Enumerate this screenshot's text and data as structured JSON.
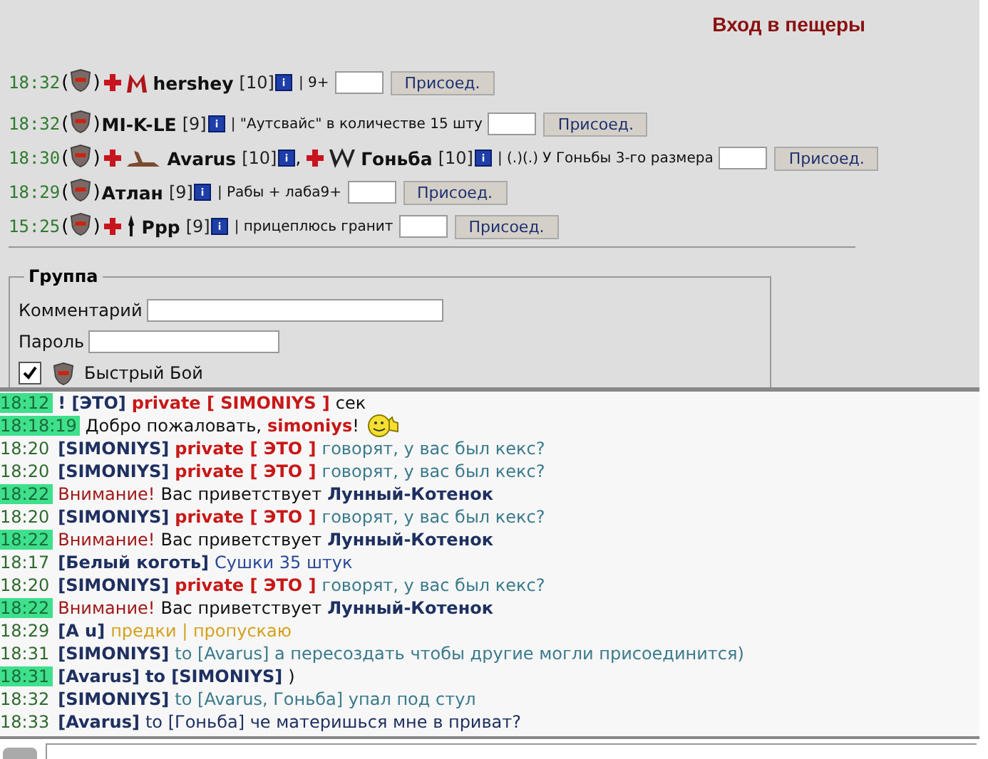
{
  "title": "Вход в пещеры",
  "games": [
    {
      "time": "18:32",
      "open": "(",
      "close": ")",
      "players": [
        {
          "name": "hershey",
          "level": "[10]",
          "cross": true,
          "emblem": {
            "kind": "letter-m"
          }
        }
      ],
      "comment": "| 9+",
      "button": "Присоед."
    },
    {
      "time": "18:32",
      "open": "(",
      "close": ")",
      "players": [
        {
          "name": "MI-K-LE",
          "level": "[9]",
          "cross": false
        }
      ],
      "comment": "| \"Аутсвайс\" в количестве 15 шту",
      "button": "Присоед."
    },
    {
      "time": "18:30",
      "open": "(",
      "close": ")",
      "players": [
        {
          "name": "Avarus",
          "level": "[10]",
          "cross": true,
          "emblem": {
            "kind": "creature"
          }
        },
        {
          "separator": ",",
          "name": "Гоньба",
          "level": "[10]",
          "cross": true,
          "emblem": {
            "kind": "letter-w"
          }
        }
      ],
      "comment": "| (.)(.) У Гоньбы 3-го размера",
      "button": "Присоед."
    },
    {
      "time": "18:29",
      "open": "(",
      "close": ")",
      "players": [
        {
          "name": "Атлан",
          "level": "[9]",
          "cross": false
        }
      ],
      "comment": "| Рабы + лаба9+",
      "button": "Присоед."
    },
    {
      "time": "15:25",
      "open": "(",
      "close": ")",
      "players": [
        {
          "name": "Ppp",
          "level": "[9]",
          "cross": true,
          "emblem": {
            "kind": "dagger"
          }
        }
      ],
      "comment": "| прицеплюсь гранит",
      "button": "Присоед."
    }
  ],
  "group": {
    "legend": "Группа",
    "comment_label": "Комментарий",
    "password_label": "Пароль",
    "quick_fight": {
      "label": "Быстрый Бой",
      "checked": true
    }
  },
  "chat": [
    {
      "time": "18:12",
      "highlight": true,
      "parts": [
        {
          "kind": "name",
          "text": "! [ЭТО]"
        },
        {
          "kind": "private",
          "text": "private [ SIMONIYS ]"
        },
        {
          "kind": "plain",
          "text": "сек"
        }
      ]
    },
    {
      "time": "18:18:19",
      "highlight": true,
      "parts": [
        {
          "kind": "plain",
          "text": "Добро пожаловать,"
        },
        {
          "kind": "private",
          "text": "simoniys"
        },
        {
          "kind": "tail",
          "text": "!"
        },
        {
          "kind": "smiley"
        }
      ]
    },
    {
      "time": "18:20",
      "highlight": false,
      "parts": [
        {
          "kind": "name",
          "text": "[SIMONIYS]"
        },
        {
          "kind": "private",
          "text": "private [ ЭТО ]"
        },
        {
          "kind": "msg",
          "text": "говорят, у вас был кекс?"
        }
      ]
    },
    {
      "time": "18:20",
      "highlight": false,
      "parts": [
        {
          "kind": "name",
          "text": "[SIMONIYS]"
        },
        {
          "kind": "private",
          "text": "private [ ЭТО ]"
        },
        {
          "kind": "msg",
          "text": "говорят, у вас был кекс?"
        }
      ]
    },
    {
      "time": "18:22",
      "highlight": true,
      "parts": [
        {
          "kind": "alert",
          "text": "Внимание!"
        },
        {
          "kind": "plain",
          "text": "Вас приветствует"
        },
        {
          "kind": "name",
          "text": "Лунный-Котенок"
        }
      ]
    },
    {
      "time": "18:20",
      "highlight": false,
      "parts": [
        {
          "kind": "name",
          "text": "[SIMONIYS]"
        },
        {
          "kind": "private",
          "text": "private [ ЭТО ]"
        },
        {
          "kind": "msg",
          "text": "говорят, у вас был кекс?"
        }
      ]
    },
    {
      "time": "18:22",
      "highlight": true,
      "parts": [
        {
          "kind": "alert",
          "text": "Внимание!"
        },
        {
          "kind": "plain",
          "text": "Вас приветствует"
        },
        {
          "kind": "name",
          "text": "Лунный-Котенок"
        }
      ]
    },
    {
      "time": "18:17",
      "highlight": false,
      "parts": [
        {
          "kind": "name",
          "text": "[Белый коготь]"
        },
        {
          "kind": "blue",
          "text": "Сушки 35 штук"
        }
      ]
    },
    {
      "time": "18:20",
      "highlight": false,
      "parts": [
        {
          "kind": "name",
          "text": "[SIMONIYS]"
        },
        {
          "kind": "private",
          "text": "private [ ЭТО ]"
        },
        {
          "kind": "msg",
          "text": "говорят, у вас был кекс?"
        }
      ]
    },
    {
      "time": "18:22",
      "highlight": true,
      "parts": [
        {
          "kind": "alert",
          "text": "Внимание!"
        },
        {
          "kind": "plain",
          "text": "Вас приветствует"
        },
        {
          "kind": "name",
          "text": "Лунный-Котенок"
        }
      ]
    },
    {
      "time": "18:29",
      "highlight": false,
      "parts": [
        {
          "kind": "name",
          "text": "[A u]"
        },
        {
          "kind": "yellow",
          "text": "предки | пропускаю"
        }
      ]
    },
    {
      "time": "18:31",
      "highlight": false,
      "parts": [
        {
          "kind": "name",
          "text": "[SIMONIYS]"
        },
        {
          "kind": "msg",
          "text": "to [Avarus] а пересоздать чтобы другие могли присоединится)"
        }
      ]
    },
    {
      "time": "18:31",
      "highlight": true,
      "parts": [
        {
          "kind": "name",
          "text": "[Avarus]"
        },
        {
          "kind": "name",
          "text": "to [SIMONIYS]"
        },
        {
          "kind": "plain",
          "text": ")"
        }
      ]
    },
    {
      "time": "18:32",
      "highlight": false,
      "parts": [
        {
          "kind": "name",
          "text": "[SIMONIYS]"
        },
        {
          "kind": "msg",
          "text": "to [Avarus, Гоньба] упал под стул"
        }
      ]
    },
    {
      "time": "18:33",
      "highlight": false,
      "parts": [
        {
          "kind": "name",
          "text": "[Avarus]"
        },
        {
          "kind": "dark",
          "text": "to [Гоньба] че материшься мне в приват?"
        }
      ]
    }
  ]
}
